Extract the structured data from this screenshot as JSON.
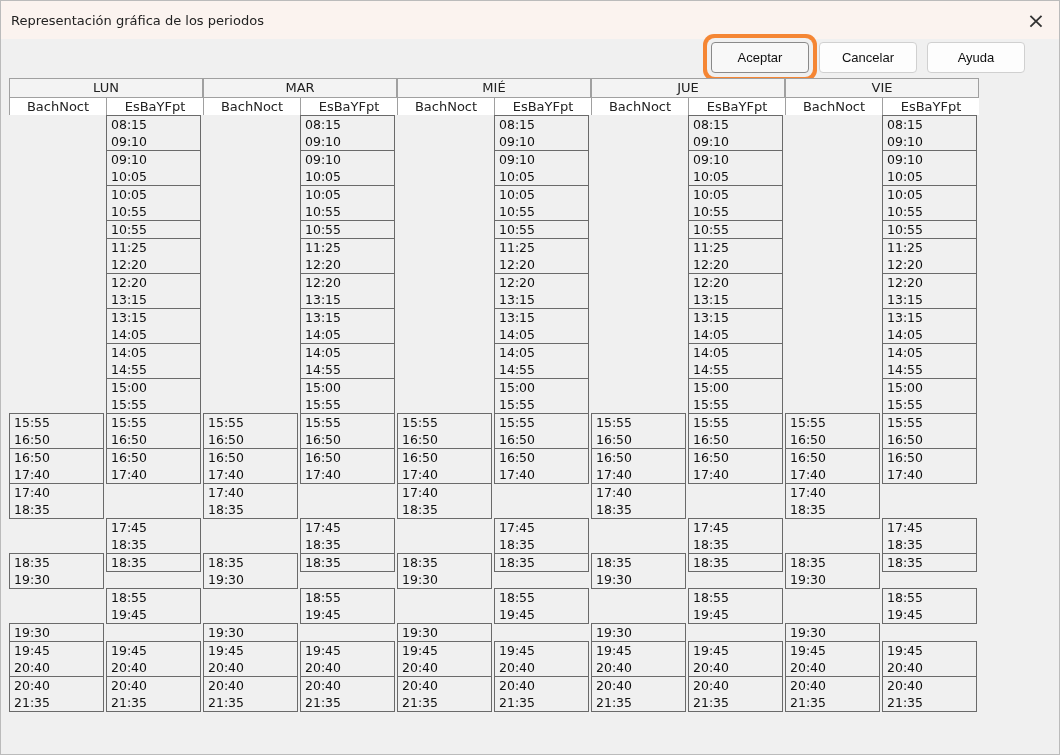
{
  "window": {
    "title": "Representación gráfica de los periodos",
    "close": "×"
  },
  "buttons": [
    {
      "label": "Aceptar",
      "focused": true
    },
    {
      "label": "Cancelar",
      "focused": false
    },
    {
      "label": "Ayuda",
      "focused": false
    }
  ],
  "days": [
    {
      "name": "LUN",
      "groups": [
        {
          "name": "BachNoct",
          "blocks": [
            [
              "15:55",
              "16:50"
            ],
            [
              "16:50",
              "17:40"
            ],
            [
              "17:40",
              "18:35"
            ],
            [
              "18:35",
              "19:30"
            ],
            [
              "19:30"
            ],
            [
              "19:45",
              "20:40"
            ],
            [
              "20:40",
              "21:35"
            ]
          ]
        },
        {
          "name": "EsBaYFpt",
          "blocks": [
            [
              "08:15",
              "09:10"
            ],
            [
              "09:10",
              "10:05"
            ],
            [
              "10:05",
              "10:55"
            ],
            [
              "10:55"
            ],
            [
              "11:25",
              "12:20"
            ],
            [
              "12:20",
              "13:15"
            ],
            [
              "13:15",
              "14:05"
            ],
            [
              "14:05",
              "14:55"
            ],
            [
              "15:00",
              "15:55"
            ],
            [
              "15:55",
              "16:50"
            ],
            [
              "16:50",
              "17:40"
            ],
            [
              "17:45",
              "18:35"
            ],
            [
              "18:35"
            ],
            [
              "18:55",
              "19:45"
            ],
            [
              "19:45",
              "20:40"
            ],
            [
              "20:40",
              "21:35"
            ]
          ]
        }
      ]
    },
    {
      "name": "MAR",
      "groups": [
        {
          "name": "BachNoct",
          "blocks": [
            [
              "15:55",
              "16:50"
            ],
            [
              "16:50",
              "17:40"
            ],
            [
              "17:40",
              "18:35"
            ],
            [
              "18:35",
              "19:30"
            ],
            [
              "19:30"
            ],
            [
              "19:45",
              "20:40"
            ],
            [
              "20:40",
              "21:35"
            ]
          ]
        },
        {
          "name": "EsBaYFpt",
          "blocks": [
            [
              "08:15",
              "09:10"
            ],
            [
              "09:10",
              "10:05"
            ],
            [
              "10:05",
              "10:55"
            ],
            [
              "10:55"
            ],
            [
              "11:25",
              "12:20"
            ],
            [
              "12:20",
              "13:15"
            ],
            [
              "13:15",
              "14:05"
            ],
            [
              "14:05",
              "14:55"
            ],
            [
              "15:00",
              "15:55"
            ],
            [
              "15:55",
              "16:50"
            ],
            [
              "16:50",
              "17:40"
            ],
            [
              "17:45",
              "18:35"
            ],
            [
              "18:35"
            ],
            [
              "18:55",
              "19:45"
            ],
            [
              "19:45",
              "20:40"
            ],
            [
              "20:40",
              "21:35"
            ]
          ]
        }
      ]
    },
    {
      "name": "MIÉ",
      "groups": [
        {
          "name": "BachNoct",
          "blocks": [
            [
              "15:55",
              "16:50"
            ],
            [
              "16:50",
              "17:40"
            ],
            [
              "17:40",
              "18:35"
            ],
            [
              "18:35",
              "19:30"
            ],
            [
              "19:30"
            ],
            [
              "19:45",
              "20:40"
            ],
            [
              "20:40",
              "21:35"
            ]
          ]
        },
        {
          "name": "EsBaYFpt",
          "blocks": [
            [
              "08:15",
              "09:10"
            ],
            [
              "09:10",
              "10:05"
            ],
            [
              "10:05",
              "10:55"
            ],
            [
              "10:55"
            ],
            [
              "11:25",
              "12:20"
            ],
            [
              "12:20",
              "13:15"
            ],
            [
              "13:15",
              "14:05"
            ],
            [
              "14:05",
              "14:55"
            ],
            [
              "15:00",
              "15:55"
            ],
            [
              "15:55",
              "16:50"
            ],
            [
              "16:50",
              "17:40"
            ],
            [
              "17:45",
              "18:35"
            ],
            [
              "18:35"
            ],
            [
              "18:55",
              "19:45"
            ],
            [
              "19:45",
              "20:40"
            ],
            [
              "20:40",
              "21:35"
            ]
          ]
        }
      ]
    },
    {
      "name": "JUE",
      "groups": [
        {
          "name": "BachNoct",
          "blocks": [
            [
              "15:55",
              "16:50"
            ],
            [
              "16:50",
              "17:40"
            ],
            [
              "17:40",
              "18:35"
            ],
            [
              "18:35",
              "19:30"
            ],
            [
              "19:30"
            ],
            [
              "19:45",
              "20:40"
            ],
            [
              "20:40",
              "21:35"
            ]
          ]
        },
        {
          "name": "EsBaYFpt",
          "blocks": [
            [
              "08:15",
              "09:10"
            ],
            [
              "09:10",
              "10:05"
            ],
            [
              "10:05",
              "10:55"
            ],
            [
              "10:55"
            ],
            [
              "11:25",
              "12:20"
            ],
            [
              "12:20",
              "13:15"
            ],
            [
              "13:15",
              "14:05"
            ],
            [
              "14:05",
              "14:55"
            ],
            [
              "15:00",
              "15:55"
            ],
            [
              "15:55",
              "16:50"
            ],
            [
              "16:50",
              "17:40"
            ],
            [
              "17:45",
              "18:35"
            ],
            [
              "18:35"
            ],
            [
              "18:55",
              "19:45"
            ],
            [
              "19:45",
              "20:40"
            ],
            [
              "20:40",
              "21:35"
            ]
          ]
        }
      ]
    },
    {
      "name": "VIE",
      "groups": [
        {
          "name": "BachNoct",
          "blocks": [
            [
              "15:55",
              "16:50"
            ],
            [
              "16:50",
              "17:40"
            ],
            [
              "17:40",
              "18:35"
            ],
            [
              "18:35",
              "19:30"
            ],
            [
              "19:30"
            ],
            [
              "19:45",
              "20:40"
            ],
            [
              "20:40",
              "21:35"
            ]
          ]
        },
        {
          "name": "EsBaYFpt",
          "blocks": [
            [
              "08:15",
              "09:10"
            ],
            [
              "09:10",
              "10:05"
            ],
            [
              "10:05",
              "10:55"
            ],
            [
              "10:55"
            ],
            [
              "11:25",
              "12:20"
            ],
            [
              "12:20",
              "13:15"
            ],
            [
              "13:15",
              "14:05"
            ],
            [
              "14:05",
              "14:55"
            ],
            [
              "15:00",
              "15:55"
            ],
            [
              "15:55",
              "16:50"
            ],
            [
              "16:50",
              "17:40"
            ],
            [
              "17:45",
              "18:35"
            ],
            [
              "18:35"
            ],
            [
              "18:55",
              "19:45"
            ],
            [
              "19:45",
              "20:40"
            ],
            [
              "20:40",
              "21:35"
            ]
          ]
        }
      ]
    }
  ]
}
